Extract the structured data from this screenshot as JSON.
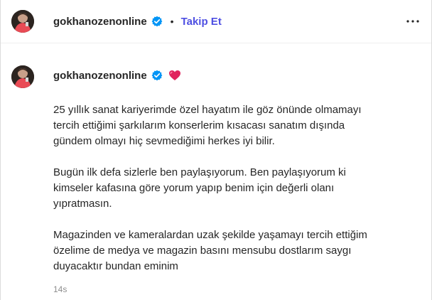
{
  "header": {
    "username": "gokhanozenonline",
    "separator": "•",
    "follow_label": "Takip Et"
  },
  "comment": {
    "username": "gokhanozenonline",
    "paragraphs": [
      "25 yıllık sanat kariyerimde özel hayatım ile göz önünde olmamayı\ntercih ettiğimi şarkılarım konserlerim kısacası sanatım dışında\ngündem olmayı hiç sevmediğimi herkes iyi bilir.",
      "Bugün ilk defa sizlerle ben paylaşıyorum. Ben paylaşıyorum ki\nkimseler kafasına göre yorum yapıp benim için değerli olanı\nyıpratmasın.",
      "Magazinden ve kameralardan uzak şekilde yaşamayı tercih ettiğim\nözelime de medya ve magazin basını mensubu dostlarım saygı\nduyacaktır bundan eminim"
    ],
    "timestamp": "14s"
  },
  "icons": {
    "verified": "verified-badge-icon",
    "heart": "heart-emoji-icon",
    "more": "more-options-icon"
  },
  "colors": {
    "follow": "#4e4fe2",
    "verified": "#0095f6",
    "heart": "#e0245e",
    "timestamp": "#8e8e8e"
  }
}
